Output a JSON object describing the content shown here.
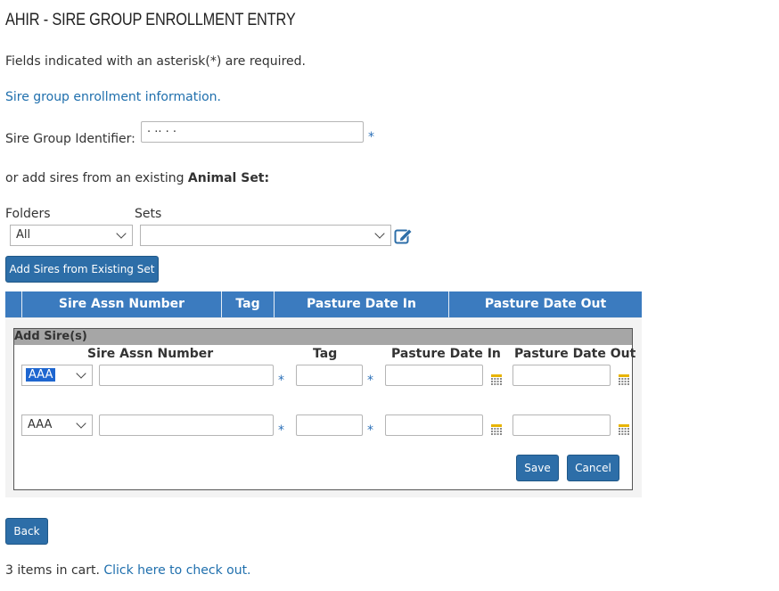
{
  "page": {
    "title": "AHIR - SIRE GROUP ENROLLMENT ENTRY",
    "required_note": "Fields indicated with an asterisk(*) are required.",
    "section_link": "Sire group enrollment information."
  },
  "sire_group": {
    "label": "Sire Group Identifier:",
    "value": "· ·· · ·",
    "required_mark": "*"
  },
  "animal_set": {
    "prefix": "or add sires from an existing ",
    "bold": "Animal Set:",
    "folders_label": "Folders",
    "folders_value": "All",
    "sets_label": "Sets",
    "sets_value": "",
    "add_button": "Add Sires from Existing Set"
  },
  "table": {
    "headers": [
      "Sire Assn Number",
      "Tag",
      "Pasture Date In",
      "Pasture Date Out"
    ]
  },
  "add_panel": {
    "title": "Add Sire(s)",
    "headers": [
      "Sire Assn Number",
      "Tag",
      "Pasture Date In",
      "Pasture Date Out"
    ],
    "rows": [
      {
        "breed": "AAA",
        "assn": "",
        "tag": "",
        "date_in": "",
        "date_out": ""
      },
      {
        "breed": "AAA",
        "assn": "",
        "tag": "",
        "date_in": "",
        "date_out": ""
      }
    ],
    "required_mark": "*",
    "save": "Save",
    "cancel": "Cancel"
  },
  "nav": {
    "back": "Back"
  },
  "cart": {
    "count_text": "3 items in cart. ",
    "checkout_link": "Click here to check out."
  },
  "colors": {
    "accent": "#2d6ea8",
    "header_blue": "#3b7bbf",
    "link": "#1f6fad"
  }
}
